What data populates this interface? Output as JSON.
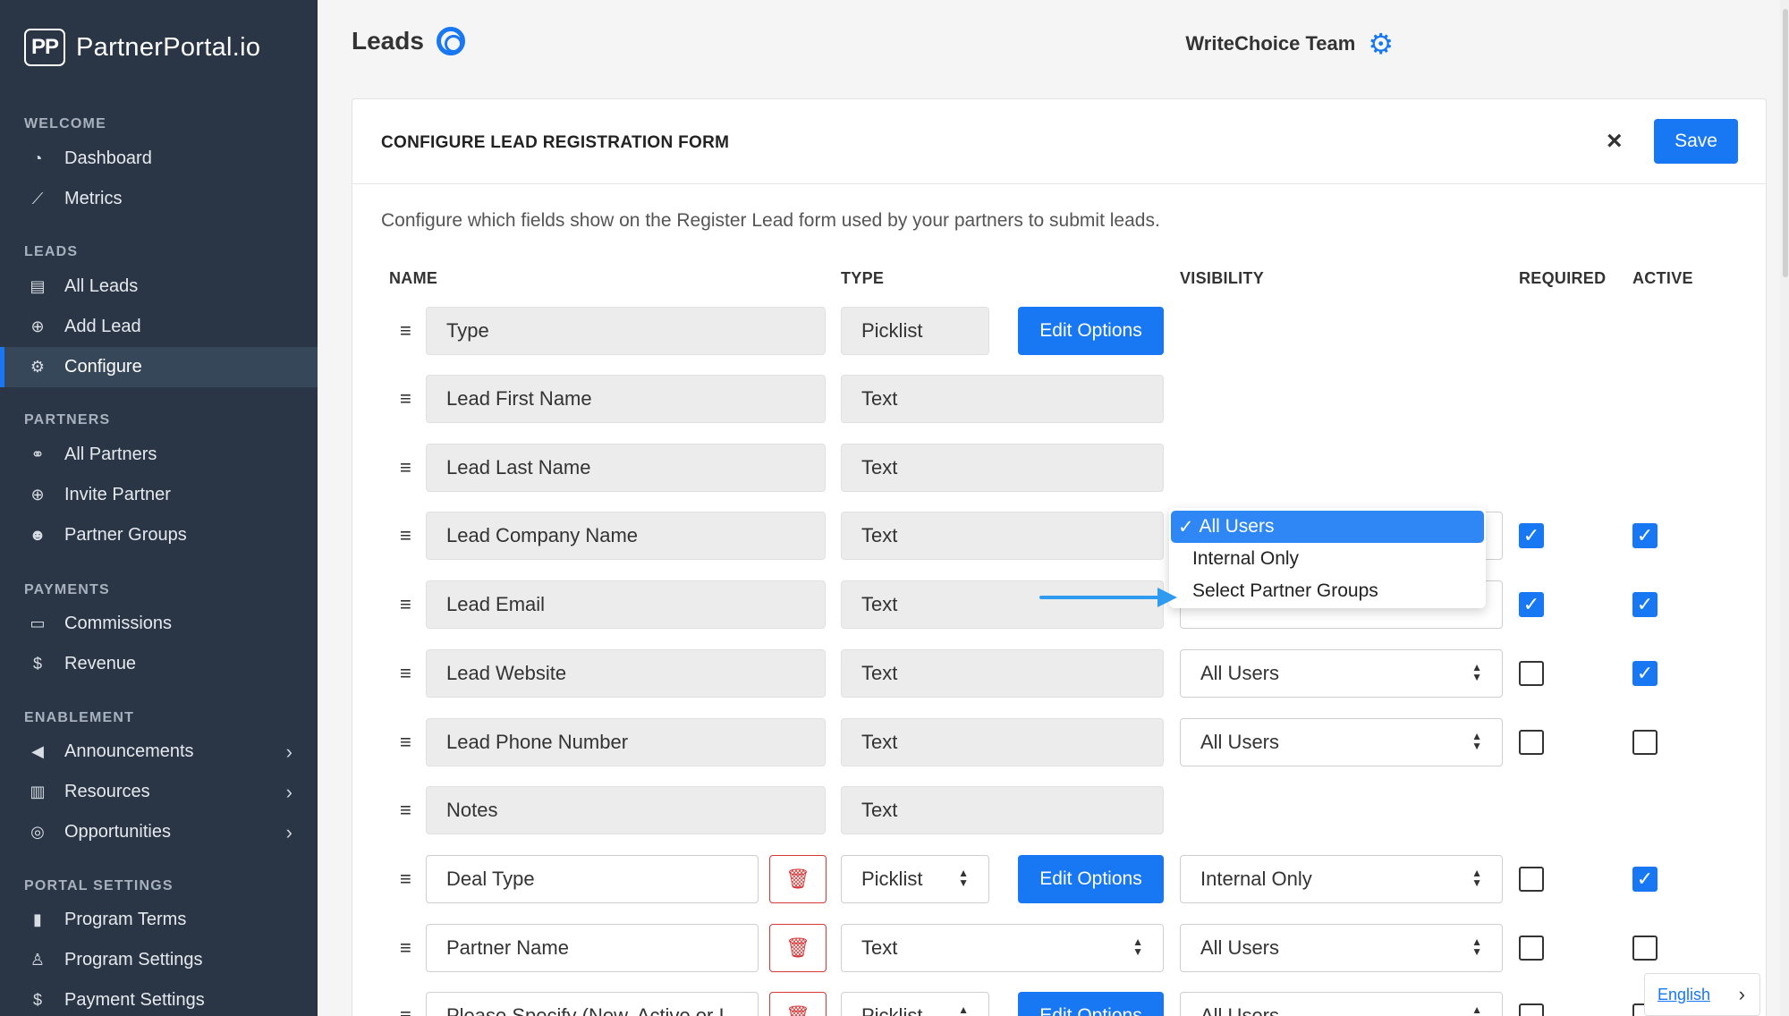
{
  "sidebar": {
    "brand_mark": "PP",
    "brand_name": "PartnerPortal.io",
    "sections": [
      {
        "title": "WELCOME",
        "items": [
          {
            "label": "Dashboard",
            "icon": "gauge-icon"
          },
          {
            "label": "Metrics",
            "icon": "chart-line-icon"
          }
        ]
      },
      {
        "title": "LEADS",
        "items": [
          {
            "label": "All Leads",
            "icon": "clipboard-icon"
          },
          {
            "label": "Add Lead",
            "icon": "plus-circle-icon"
          },
          {
            "label": "Configure",
            "icon": "gear-icon",
            "active": true
          }
        ]
      },
      {
        "title": "PARTNERS",
        "items": [
          {
            "label": "All Partners",
            "icon": "handshake-icon"
          },
          {
            "label": "Invite Partner",
            "icon": "plus-circle-icon"
          },
          {
            "label": "Partner Groups",
            "icon": "users-icon"
          }
        ]
      },
      {
        "title": "PAYMENTS",
        "items": [
          {
            "label": "Commissions",
            "icon": "credit-card-icon"
          },
          {
            "label": "Revenue",
            "icon": "dollar-icon"
          }
        ]
      },
      {
        "title": "ENABLEMENT",
        "items": [
          {
            "label": "Announcements",
            "icon": "megaphone-icon"
          },
          {
            "label": "Resources",
            "icon": "book-icon"
          },
          {
            "label": "Opportunities",
            "icon": "target-icon"
          }
        ]
      },
      {
        "title": "PORTAL SETTINGS",
        "items": [
          {
            "label": "Program Terms",
            "icon": "file-icon"
          },
          {
            "label": "Program Settings",
            "icon": "award-icon"
          },
          {
            "label": "Payment Settings",
            "icon": "dollar-icon"
          }
        ]
      }
    ]
  },
  "header": {
    "title": "Leads",
    "team": "WriteChoice Team"
  },
  "card": {
    "title": "CONFIGURE LEAD REGISTRATION FORM",
    "close": "×",
    "save": "Save",
    "description": "Configure which fields show on the Register Lead form used by your partners to submit leads.",
    "columns": {
      "name": "NAME",
      "type": "TYPE",
      "visibility": "VISIBILITY",
      "required": "REQUIRED",
      "active": "ACTIVE"
    },
    "edit_options": "Edit Options"
  },
  "rows": [
    {
      "name": "Type",
      "type": "Picklist",
      "edit": true
    },
    {
      "name": "Lead First Name",
      "type": "Text"
    },
    {
      "name": "Lead Last Name",
      "type": "Text"
    },
    {
      "name": "Lead Company Name",
      "type": "Text",
      "required": true,
      "active": true
    },
    {
      "name": "Lead Email",
      "type": "Text",
      "required": true,
      "active": true
    },
    {
      "name": "Lead Website",
      "type": "Text",
      "visibility": "All Users",
      "required": false,
      "active": true
    },
    {
      "name": "Lead Phone Number",
      "type": "Text",
      "visibility": "All Users",
      "required": false,
      "active": false
    },
    {
      "name": "Notes",
      "type": "Text"
    },
    {
      "name": "Deal Type",
      "type": "Picklist",
      "visibility": "Internal Only",
      "required": false,
      "active": true,
      "custom": true,
      "edit": true
    },
    {
      "name": "Partner Name",
      "type": "Text",
      "visibility": "All Users",
      "required": false,
      "active": false,
      "custom": true
    },
    {
      "name": "Please Specify (New, Active or I",
      "type": "Picklist",
      "visibility": "All Users",
      "required": false,
      "active": false,
      "custom": true,
      "edit": true
    }
  ],
  "dropdown": {
    "options": [
      "All Users",
      "Internal Only",
      "Select Partner Groups"
    ],
    "selected": "All Users",
    "check": "✓"
  },
  "language": "English",
  "colors": {
    "accent": "#1877f2",
    "sidebar": "#2a3645",
    "danger": "#d93636",
    "annotation_arrow": "#2f9bf0"
  }
}
